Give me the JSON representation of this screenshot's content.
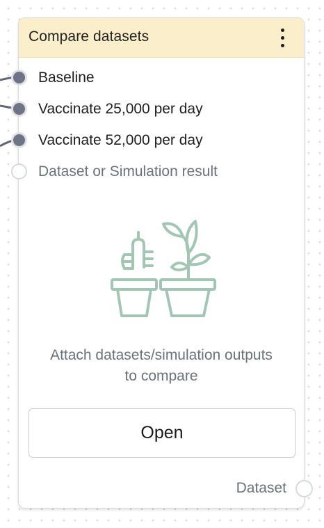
{
  "node": {
    "title": "Compare datasets",
    "menu_icon": "kebab-vertical-icon",
    "inputs": [
      {
        "label": "Baseline",
        "connected": true
      },
      {
        "label": "Vaccinate 25,000 per day",
        "connected": true
      },
      {
        "label": "Vaccinate 52,000 per day",
        "connected": true
      },
      {
        "label": "Dataset or Simulation result",
        "connected": false
      }
    ],
    "illustration_icon": "potted-plants-icon",
    "empty_message_line1": "Attach datasets/simulation outputs",
    "empty_message_line2": "to compare",
    "open_label": "Open",
    "output_label": "Dataset",
    "colors": {
      "header_bg": "#fbeecb",
      "port_connected": "#6e7486",
      "illustration": "#a3c6b4",
      "edge": "#5f6675"
    }
  }
}
